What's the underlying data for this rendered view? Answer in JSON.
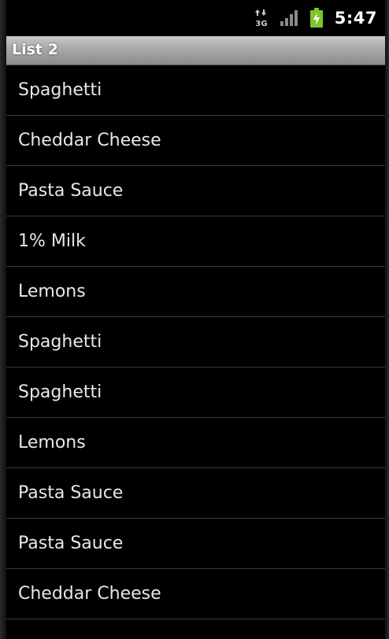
{
  "status_bar": {
    "network_icon": "3g-data-arrows-icon",
    "network_label": "3G",
    "signal_icon": "signal-strength-icon",
    "battery_icon": "battery-charging-icon",
    "time": "5:47"
  },
  "title_bar": {
    "title": "List 2"
  },
  "colors": {
    "background": "#000000",
    "title_bar": "#a8a8a8",
    "divider": "#3a3a3a",
    "item_text": "#e8e8e8",
    "battery_green": "#7bc628"
  },
  "list": {
    "items": [
      {
        "label": "Spaghetti"
      },
      {
        "label": "Cheddar Cheese"
      },
      {
        "label": "Pasta Sauce"
      },
      {
        "label": "1% Milk"
      },
      {
        "label": "Lemons"
      },
      {
        "label": "Spaghetti"
      },
      {
        "label": "Spaghetti"
      },
      {
        "label": "Lemons"
      },
      {
        "label": "Pasta Sauce"
      },
      {
        "label": "Pasta Sauce"
      },
      {
        "label": "Cheddar Cheese"
      }
    ]
  }
}
